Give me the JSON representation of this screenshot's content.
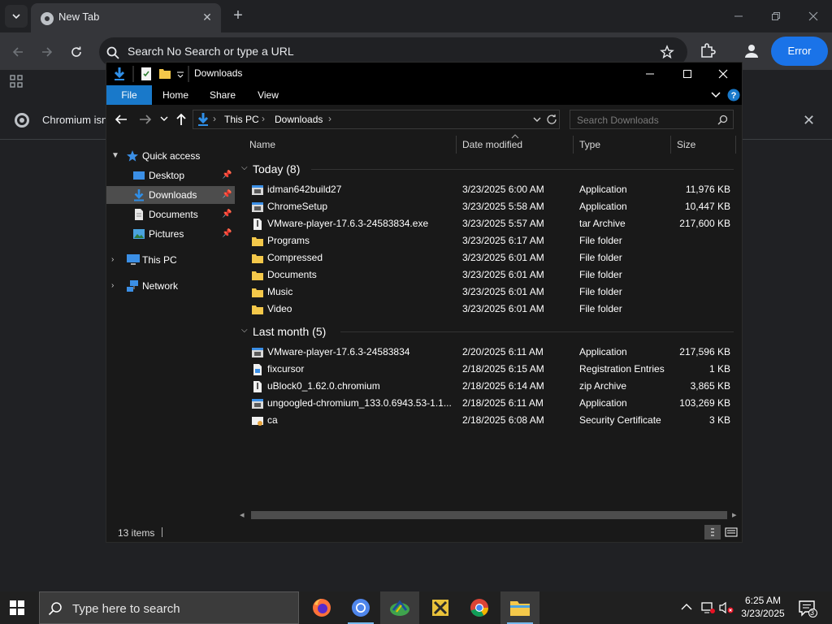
{
  "browser": {
    "tab_title": "New Tab",
    "omnibox_text": "Search No Search or type a URL",
    "error_button": "Error",
    "infobar_message": "Chromium isn",
    "colors": {
      "bg": "#202124",
      "toolbar": "#35363a",
      "accent": "#1a73e8"
    }
  },
  "explorer": {
    "title": "Downloads",
    "ribbon_tabs": [
      "File",
      "Home",
      "Share",
      "View"
    ],
    "breadcrumb": [
      "This PC",
      "Downloads"
    ],
    "search_placeholder": "Search Downloads",
    "nav": {
      "quick_access": "Quick access",
      "items": [
        {
          "label": "Desktop",
          "icon": "desktop-icon",
          "pinned": true
        },
        {
          "label": "Downloads",
          "icon": "downloads-icon",
          "pinned": true,
          "selected": true
        },
        {
          "label": "Documents",
          "icon": "documents-icon",
          "pinned": true
        },
        {
          "label": "Pictures",
          "icon": "pictures-icon",
          "pinned": true
        }
      ],
      "this_pc": "This PC",
      "network": "Network"
    },
    "columns": [
      "Name",
      "Date modified",
      "Type",
      "Size"
    ],
    "groups": [
      {
        "name": "Today (8)",
        "files": [
          {
            "name": "idman642build27",
            "date": "3/23/2025 6:00 AM",
            "type": "Application",
            "size": "11,976 KB",
            "icon": "app-icon"
          },
          {
            "name": "ChromeSetup",
            "date": "3/23/2025 5:58 AM",
            "type": "Application",
            "size": "10,447 KB",
            "icon": "app-icon"
          },
          {
            "name": "VMware-player-17.6.3-24583834.exe",
            "date": "3/23/2025 5:57 AM",
            "type": "tar Archive",
            "size": "217,600 KB",
            "icon": "archive-icon"
          },
          {
            "name": "Programs",
            "date": "3/23/2025 6:17 AM",
            "type": "File folder",
            "size": "",
            "icon": "folder-icon"
          },
          {
            "name": "Compressed",
            "date": "3/23/2025 6:01 AM",
            "type": "File folder",
            "size": "",
            "icon": "folder-icon"
          },
          {
            "name": "Documents",
            "date": "3/23/2025 6:01 AM",
            "type": "File folder",
            "size": "",
            "icon": "folder-icon"
          },
          {
            "name": "Music",
            "date": "3/23/2025 6:01 AM",
            "type": "File folder",
            "size": "",
            "icon": "folder-icon"
          },
          {
            "name": "Video",
            "date": "3/23/2025 6:01 AM",
            "type": "File folder",
            "size": "",
            "icon": "folder-icon"
          }
        ]
      },
      {
        "name": "Last month (5)",
        "files": [
          {
            "name": "VMware-player-17.6.3-24583834",
            "date": "2/20/2025 6:11 AM",
            "type": "Application",
            "size": "217,596 KB",
            "icon": "app-icon"
          },
          {
            "name": "fixcursor",
            "date": "2/18/2025 6:15 AM",
            "type": "Registration Entries",
            "size": "1 KB",
            "icon": "registry-icon"
          },
          {
            "name": "uBlock0_1.62.0.chromium",
            "date": "2/18/2025 6:14 AM",
            "type": "zip Archive",
            "size": "3,865 KB",
            "icon": "archive-icon"
          },
          {
            "name": "ungoogled-chromium_133.0.6943.53-1.1...",
            "date": "2/18/2025 6:11 AM",
            "type": "Application",
            "size": "103,269 KB",
            "icon": "app-icon"
          },
          {
            "name": "ca",
            "date": "2/18/2025 6:08 AM",
            "type": "Security Certificate",
            "size": "3 KB",
            "icon": "certificate-icon"
          }
        ]
      }
    ],
    "status_count": "13 items"
  },
  "taskbar": {
    "search_placeholder": "Type here to search",
    "time": "6:25 AM",
    "date": "3/23/2025",
    "notification_count": "3",
    "apps": [
      "firefox-icon",
      "chromium-icon",
      "idm-icon",
      "archive-app-icon",
      "chrome-icon",
      "file-explorer-icon"
    ]
  }
}
